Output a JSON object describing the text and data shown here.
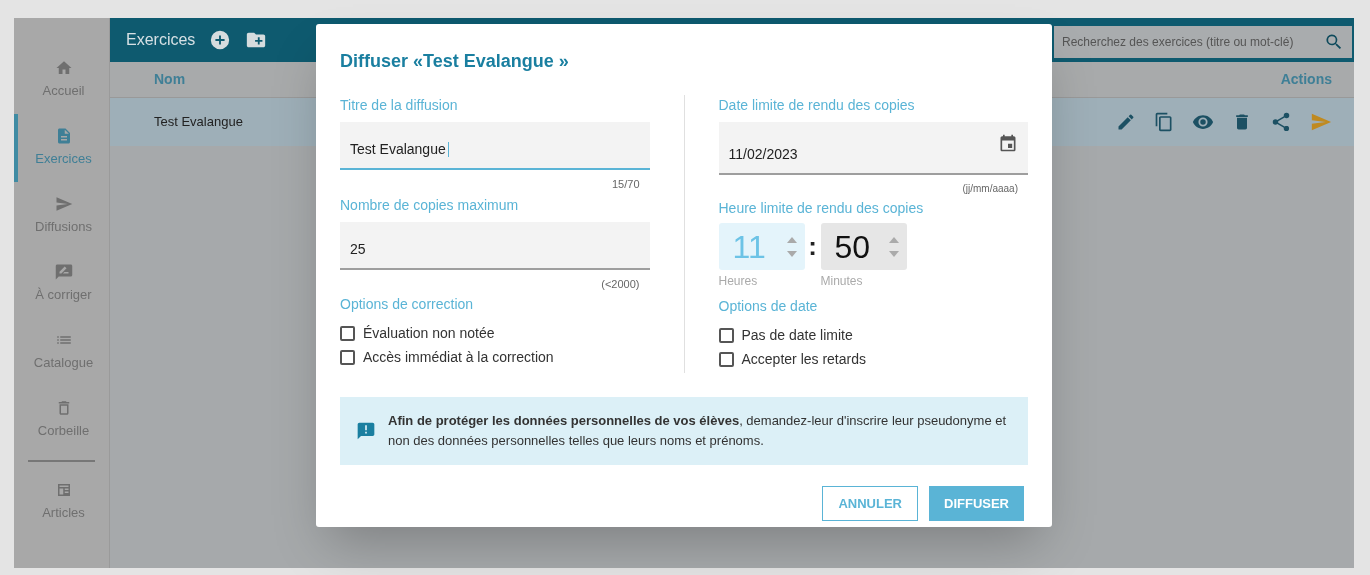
{
  "sidebar": {
    "items": [
      {
        "label": "Accueil",
        "selected": false
      },
      {
        "label": "Exercices",
        "selected": true
      },
      {
        "label": "Diffusions",
        "selected": false
      },
      {
        "label": "À corriger",
        "selected": false
      },
      {
        "label": "Catalogue",
        "selected": false
      },
      {
        "label": "Corbeille",
        "selected": false
      }
    ],
    "bottom_items": [
      {
        "label": "Articles",
        "selected": false
      }
    ]
  },
  "header": {
    "title": "Exercices",
    "search": {
      "placeholder": "Recherchez des exercices (titre ou mot-clé)"
    }
  },
  "table": {
    "columns": [
      "Nom",
      "Actions"
    ],
    "rows": [
      {
        "name": "Test Evalangue"
      }
    ]
  },
  "dialog": {
    "title": "Diffuser «Test Evalangue »",
    "left": {
      "title_field": {
        "label": "Titre de la diffusion",
        "value": "Test Evalangue",
        "hint": "15/70",
        "focused": true
      },
      "copies_field": {
        "label": "Nombre de copies maximum",
        "value": "25",
        "hint": "(<2000)",
        "focused": false
      },
      "options_title": "Options de correction",
      "options": [
        {
          "label": "Évaluation non notée",
          "checked": false
        },
        {
          "label": "Accès immédiat à la correction",
          "checked": false
        }
      ]
    },
    "right": {
      "date_field": {
        "label": "Date limite de rendu des copies",
        "value": "11/02/2023",
        "hint": "(jj/mm/aaaa)",
        "focused": false
      },
      "time": {
        "label": "Heure limite de rendu des copies",
        "separator": ":",
        "parts": [
          {
            "value": "11",
            "caption": "Heures",
            "focused": true
          },
          {
            "value": "50",
            "caption": "Minutes",
            "focused": false
          }
        ]
      },
      "options_title": "Options de date",
      "options": [
        {
          "label": "Pas de date limite",
          "checked": false
        },
        {
          "label": "Accepter les retards",
          "checked": false
        }
      ]
    },
    "notice": "**Afin de protéger les données personnelles de vos élèves**, demandez-leur d'inscrire leur pseudonyme et non des données personnelles telles que leurs noms et prénoms.",
    "buttons": [
      {
        "label": "ANNULER",
        "kind": "outlined"
      },
      {
        "label": "DIFFUSER",
        "kind": "filled"
      }
    ]
  }
}
